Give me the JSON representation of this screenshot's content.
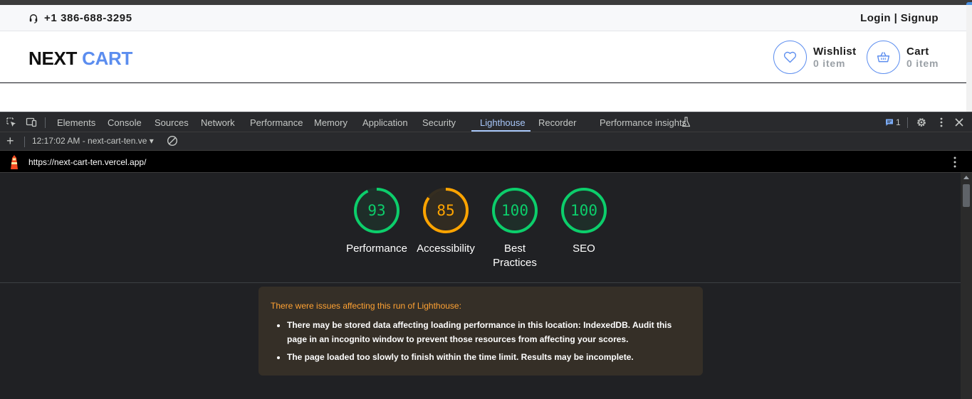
{
  "site": {
    "phone": "+1 386-688-3295",
    "login": "Login",
    "separator": "|",
    "signup": "Signup",
    "logo_part1": "NEXT",
    "logo_part2": "CART",
    "wishlist": {
      "title": "Wishlist",
      "count": "0 item"
    },
    "cart": {
      "title": "Cart",
      "count": "0 item"
    },
    "accent_color": "#5b8def"
  },
  "devtools": {
    "tabs": [
      "Elements",
      "Console",
      "Sources",
      "Network",
      "Performance",
      "Memory",
      "Application",
      "Security",
      "Lighthouse",
      "Recorder",
      "Performance insights"
    ],
    "active_tab": "Lighthouse",
    "issues_count": "1",
    "run_selector": "12:17:02 AM - next-cart-ten.ve",
    "report_url": "https://next-cart-ten.vercel.app/"
  },
  "report": {
    "scores": [
      {
        "label": "Performance",
        "value": "93",
        "color": "#0cce6b"
      },
      {
        "label": "Accessibility",
        "value": "85",
        "color": "#ffa400"
      },
      {
        "label": "Best Practices",
        "value": "100",
        "color": "#0cce6b"
      },
      {
        "label": "SEO",
        "value": "100",
        "color": "#0cce6b"
      }
    ],
    "warning_title": "There were issues affecting this run of Lighthouse:",
    "warnings": [
      "There may be stored data affecting loading performance in this location: IndexedDB. Audit this page in an incognito window to prevent those resources from affecting your scores.",
      "The page loaded too slowly to finish within the time limit. Results may be incomplete."
    ]
  }
}
